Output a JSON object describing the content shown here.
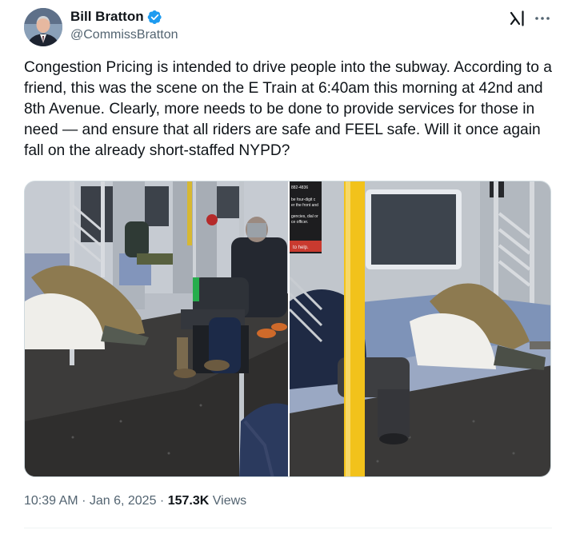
{
  "tweet": {
    "author": {
      "display_name": "Bill Bratton",
      "handle": "@CommissBratton",
      "verified": true
    },
    "text": "Congestion Pricing is intended to drive people into the subway. According to a friend, this was the scene on the E Train at 6:40am this morning at 42nd and 8th Avenue. Clearly, more needs to be done to provide services for those in need — and ensure that all riders are safe and FEEL safe. Will it once again fall on the already short-staffed NYPD?",
    "time": "10:39 AM",
    "date": "Jan 6, 2025",
    "separator": "·",
    "views_count": "157.3K",
    "views_label": "Views",
    "media": {
      "photo_count": 2,
      "signage_left": [
        "882-4836",
        "be four-digit c",
        "er the front and",
        "gencies, dial or",
        "ce officer.",
        "to help."
      ]
    }
  },
  "icons": {
    "verified": "verified-badge-icon",
    "grok": "grok-icon",
    "more": "more-options-icon"
  },
  "colors": {
    "verified_blue": "#1d9bf0",
    "secondary_text": "#536471",
    "primary_text": "#0f1419",
    "pole_yellow": "#f2c21b",
    "seat_blue": "#7e93b8"
  }
}
